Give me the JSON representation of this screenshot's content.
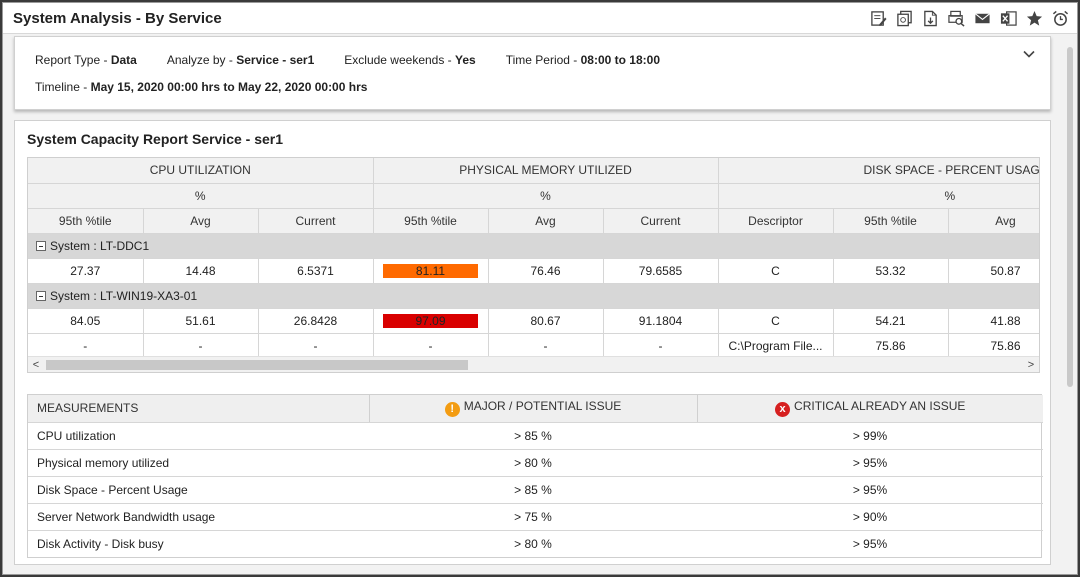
{
  "window": {
    "title": "System Analysis - By Service"
  },
  "toolbar": {
    "icons": [
      "edit-report-icon",
      "copy-report-icon",
      "export-file-icon",
      "print-preview-icon",
      "email-icon",
      "excel-icon",
      "favorite-star-icon",
      "alarm-schedule-icon"
    ]
  },
  "filters": {
    "report_type_label": "Report Type - ",
    "report_type": "Data",
    "analyze_label": "Analyze by - ",
    "analyze": "Service - ser1",
    "weekends_label": "Exclude weekends - ",
    "weekends": "Yes",
    "period_label": "Time Period - ",
    "period": "08:00 to 18:00",
    "timeline_label": "Timeline - ",
    "timeline": "May 15, 2020 00:00 hrs to May 22, 2020 00:00 hrs"
  },
  "report": {
    "title": "System Capacity Report Service - ser1",
    "groups": [
      "CPU UTILIZATION",
      "PHYSICAL MEMORY UTILIZED",
      "DISK SPACE - PERCENT USAGE"
    ],
    "unit": "%",
    "columns": [
      "95th %tile",
      "Avg",
      "Current",
      "95th %tile",
      "Avg",
      "Current",
      "Descriptor",
      "95th %tile",
      "Avg"
    ],
    "systems": [
      {
        "label": "System : LT-DDC1",
        "rows": [
          [
            "27.37",
            "14.48",
            "6.5371",
            "81.11",
            "76.46",
            "79.6585",
            "C",
            "53.32",
            "50.87"
          ]
        ],
        "highlight_color": "#ff6a00"
      },
      {
        "label": "System : LT-WIN19-XA3-01",
        "rows": [
          [
            "84.05",
            "51.61",
            "26.8428",
            "97.09",
            "80.67",
            "91.1804",
            "C",
            "54.21",
            "41.88"
          ],
          [
            "-",
            "-",
            "-",
            "-",
            "-",
            "-",
            "C:\\Program File...",
            "75.86",
            "75.86"
          ]
        ],
        "highlight_color": "#d90000"
      }
    ],
    "scroll_left": "<",
    "scroll_right": ">"
  },
  "measurements": {
    "headers": [
      "MEASUREMENTS",
      "MAJOR / POTENTIAL ISSUE",
      "CRITICAL ALREADY AN ISSUE"
    ],
    "major_icon": "!",
    "critical_icon": "x",
    "major_color": "#f39c12",
    "critical_color": "#d62020",
    "rows": [
      [
        "CPU utilization",
        "> 85 %",
        "> 99%"
      ],
      [
        "Physical memory utilized",
        "> 80 %",
        "> 95%"
      ],
      [
        "Disk Space - Percent Usage",
        "> 85 %",
        "> 95%"
      ],
      [
        "Server Network Bandwidth usage",
        "> 75 %",
        "> 90%"
      ],
      [
        "Disk Activity - Disk busy",
        "> 80 %",
        "> 95%"
      ]
    ]
  }
}
